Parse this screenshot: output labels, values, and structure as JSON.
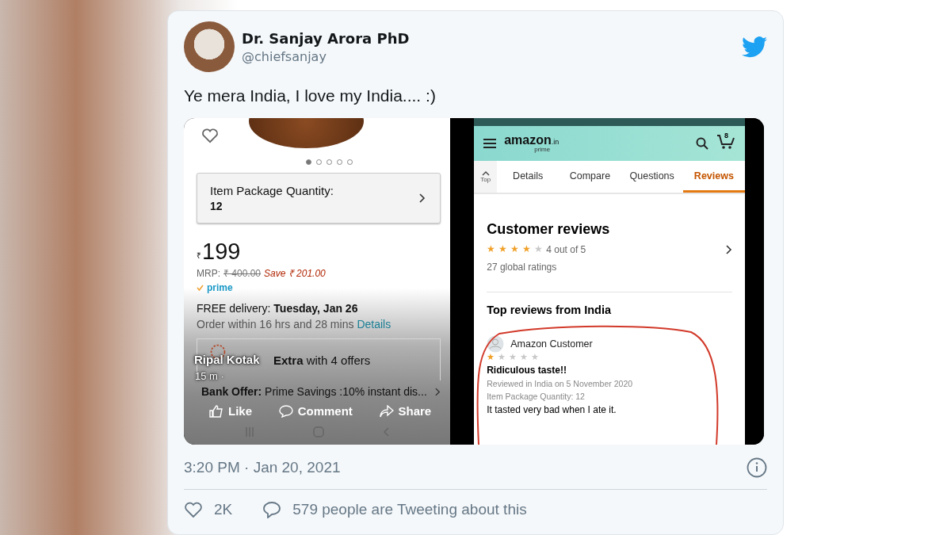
{
  "tweet": {
    "author": {
      "name": "Dr. Sanjay Arora PhD",
      "handle": "@chiefsanjay"
    },
    "text": "Ye mera India, I love my India.... :)",
    "media": {
      "left": {
        "dots": [
          {
            "selected": true
          },
          {
            "selected": false
          },
          {
            "selected": false
          },
          {
            "selected": false
          },
          {
            "selected": false
          }
        ],
        "quantity": {
          "label": "Item Package Quantity:",
          "value": "12"
        },
        "currency": "₹",
        "price": "199",
        "mrp_label": "MRP:",
        "mrp": "₹ 400.00",
        "save": "Save ₹ 201.00",
        "prime": "prime",
        "delivery_label": "FREE delivery:",
        "delivery_date": "Tuesday, Jan 26",
        "order_within": "Order within 16 hrs and 28 mins",
        "details_link": "Details",
        "offers": "**Extra** with 4 offers",
        "bank_offer": "**Bank Offer:** Prime Savings :10% instant dis...",
        "overlay": {
          "name": "Ripal Kotak",
          "time": "15 m ·"
        },
        "actions": [
          "Like",
          "Comment",
          "Share"
        ]
      },
      "right": {
        "logo": {
          "word": "amazon",
          "domain": ".in",
          "sub": "prime"
        },
        "cart_count": "8",
        "tabs": [
          {
            "label": "Top",
            "kind": "top",
            "selected": false
          },
          {
            "label": "Details",
            "kind": "tab",
            "selected": false
          },
          {
            "label": "Compare",
            "kind": "tab",
            "selected": false
          },
          {
            "label": "Questions",
            "kind": "tab",
            "selected": false
          },
          {
            "label": "Reviews",
            "kind": "tab",
            "selected": true
          }
        ],
        "reviews_title": "Customer reviews",
        "rating": {
          "stars": 4,
          "text": "4 out of 5"
        },
        "global_ratings": "27 global ratings",
        "top_reviews_title": "Top reviews from India",
        "review": {
          "author": "Amazon Customer",
          "stars": 1,
          "title": "Ridiculous taste!!",
          "meta": "Reviewed in India on 5 November 2020",
          "variant": "Item Package Quantity: 12",
          "body": "It tasted very bad when I ate it."
        }
      }
    },
    "timestamp": "3:20 PM · Jan 20, 2021",
    "likes": "2K",
    "discussion": "579 people are Tweeting about this"
  }
}
